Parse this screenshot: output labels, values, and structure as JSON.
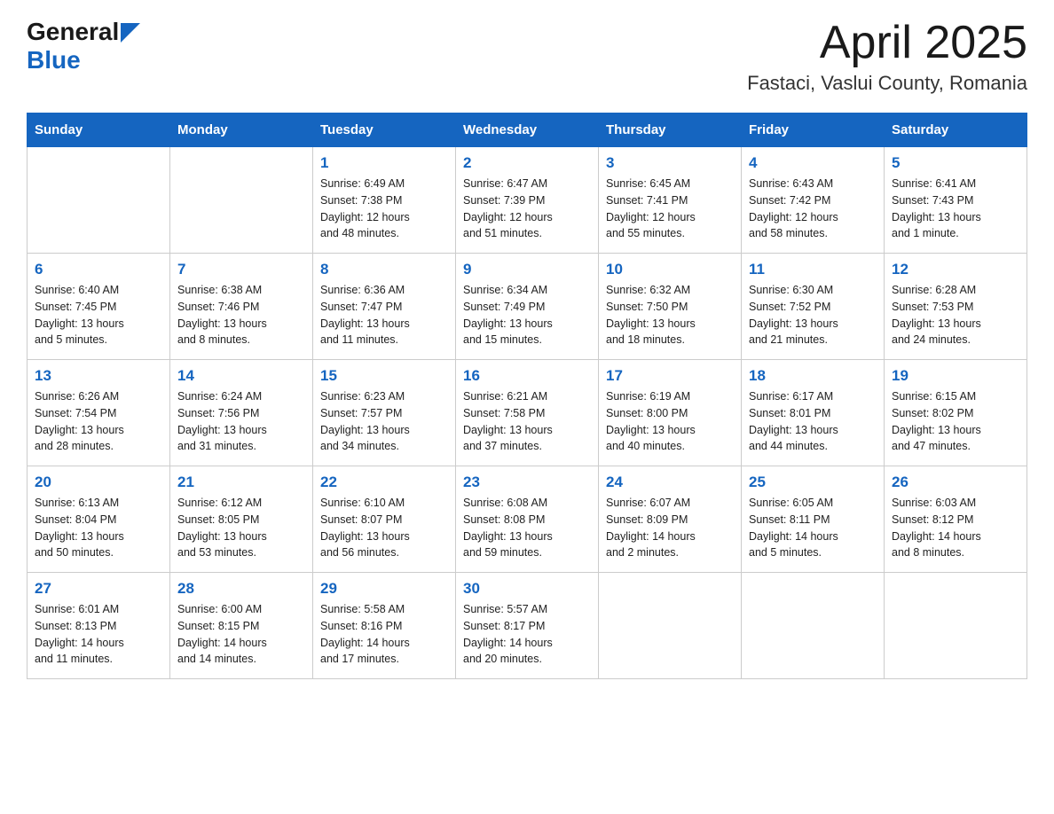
{
  "header": {
    "logo_general": "General",
    "logo_blue": "Blue",
    "month_title": "April 2025",
    "location": "Fastaci, Vaslui County, Romania"
  },
  "calendar": {
    "days_of_week": [
      "Sunday",
      "Monday",
      "Tuesday",
      "Wednesday",
      "Thursday",
      "Friday",
      "Saturday"
    ],
    "weeks": [
      [
        {
          "day": "",
          "info": ""
        },
        {
          "day": "",
          "info": ""
        },
        {
          "day": "1",
          "info": "Sunrise: 6:49 AM\nSunset: 7:38 PM\nDaylight: 12 hours\nand 48 minutes."
        },
        {
          "day": "2",
          "info": "Sunrise: 6:47 AM\nSunset: 7:39 PM\nDaylight: 12 hours\nand 51 minutes."
        },
        {
          "day": "3",
          "info": "Sunrise: 6:45 AM\nSunset: 7:41 PM\nDaylight: 12 hours\nand 55 minutes."
        },
        {
          "day": "4",
          "info": "Sunrise: 6:43 AM\nSunset: 7:42 PM\nDaylight: 12 hours\nand 58 minutes."
        },
        {
          "day": "5",
          "info": "Sunrise: 6:41 AM\nSunset: 7:43 PM\nDaylight: 13 hours\nand 1 minute."
        }
      ],
      [
        {
          "day": "6",
          "info": "Sunrise: 6:40 AM\nSunset: 7:45 PM\nDaylight: 13 hours\nand 5 minutes."
        },
        {
          "day": "7",
          "info": "Sunrise: 6:38 AM\nSunset: 7:46 PM\nDaylight: 13 hours\nand 8 minutes."
        },
        {
          "day": "8",
          "info": "Sunrise: 6:36 AM\nSunset: 7:47 PM\nDaylight: 13 hours\nand 11 minutes."
        },
        {
          "day": "9",
          "info": "Sunrise: 6:34 AM\nSunset: 7:49 PM\nDaylight: 13 hours\nand 15 minutes."
        },
        {
          "day": "10",
          "info": "Sunrise: 6:32 AM\nSunset: 7:50 PM\nDaylight: 13 hours\nand 18 minutes."
        },
        {
          "day": "11",
          "info": "Sunrise: 6:30 AM\nSunset: 7:52 PM\nDaylight: 13 hours\nand 21 minutes."
        },
        {
          "day": "12",
          "info": "Sunrise: 6:28 AM\nSunset: 7:53 PM\nDaylight: 13 hours\nand 24 minutes."
        }
      ],
      [
        {
          "day": "13",
          "info": "Sunrise: 6:26 AM\nSunset: 7:54 PM\nDaylight: 13 hours\nand 28 minutes."
        },
        {
          "day": "14",
          "info": "Sunrise: 6:24 AM\nSunset: 7:56 PM\nDaylight: 13 hours\nand 31 minutes."
        },
        {
          "day": "15",
          "info": "Sunrise: 6:23 AM\nSunset: 7:57 PM\nDaylight: 13 hours\nand 34 minutes."
        },
        {
          "day": "16",
          "info": "Sunrise: 6:21 AM\nSunset: 7:58 PM\nDaylight: 13 hours\nand 37 minutes."
        },
        {
          "day": "17",
          "info": "Sunrise: 6:19 AM\nSunset: 8:00 PM\nDaylight: 13 hours\nand 40 minutes."
        },
        {
          "day": "18",
          "info": "Sunrise: 6:17 AM\nSunset: 8:01 PM\nDaylight: 13 hours\nand 44 minutes."
        },
        {
          "day": "19",
          "info": "Sunrise: 6:15 AM\nSunset: 8:02 PM\nDaylight: 13 hours\nand 47 minutes."
        }
      ],
      [
        {
          "day": "20",
          "info": "Sunrise: 6:13 AM\nSunset: 8:04 PM\nDaylight: 13 hours\nand 50 minutes."
        },
        {
          "day": "21",
          "info": "Sunrise: 6:12 AM\nSunset: 8:05 PM\nDaylight: 13 hours\nand 53 minutes."
        },
        {
          "day": "22",
          "info": "Sunrise: 6:10 AM\nSunset: 8:07 PM\nDaylight: 13 hours\nand 56 minutes."
        },
        {
          "day": "23",
          "info": "Sunrise: 6:08 AM\nSunset: 8:08 PM\nDaylight: 13 hours\nand 59 minutes."
        },
        {
          "day": "24",
          "info": "Sunrise: 6:07 AM\nSunset: 8:09 PM\nDaylight: 14 hours\nand 2 minutes."
        },
        {
          "day": "25",
          "info": "Sunrise: 6:05 AM\nSunset: 8:11 PM\nDaylight: 14 hours\nand 5 minutes."
        },
        {
          "day": "26",
          "info": "Sunrise: 6:03 AM\nSunset: 8:12 PM\nDaylight: 14 hours\nand 8 minutes."
        }
      ],
      [
        {
          "day": "27",
          "info": "Sunrise: 6:01 AM\nSunset: 8:13 PM\nDaylight: 14 hours\nand 11 minutes."
        },
        {
          "day": "28",
          "info": "Sunrise: 6:00 AM\nSunset: 8:15 PM\nDaylight: 14 hours\nand 14 minutes."
        },
        {
          "day": "29",
          "info": "Sunrise: 5:58 AM\nSunset: 8:16 PM\nDaylight: 14 hours\nand 17 minutes."
        },
        {
          "day": "30",
          "info": "Sunrise: 5:57 AM\nSunset: 8:17 PM\nDaylight: 14 hours\nand 20 minutes."
        },
        {
          "day": "",
          "info": ""
        },
        {
          "day": "",
          "info": ""
        },
        {
          "day": "",
          "info": ""
        }
      ]
    ]
  }
}
